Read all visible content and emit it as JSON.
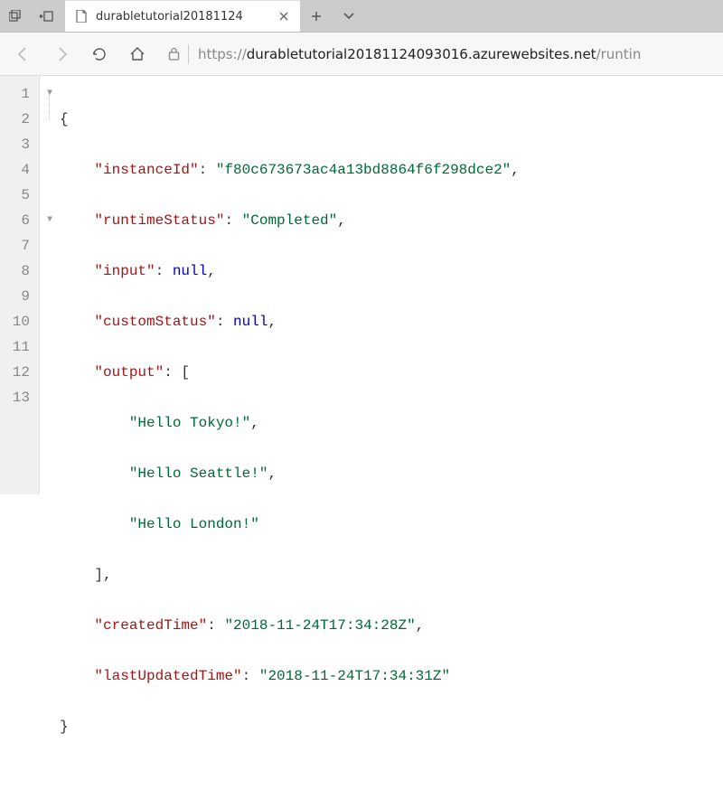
{
  "titlebar": {
    "tab_title": "durabletutorial20181124"
  },
  "navbar": {
    "url_scheme": "https://",
    "url_host": "durabletutorial20181124093016.azurewebsites.net",
    "url_path": "/runtin"
  },
  "code": {
    "line1": "{",
    "keys": {
      "instanceId": "\"instanceId\"",
      "runtimeStatus": "\"runtimeStatus\"",
      "input": "\"input\"",
      "customStatus": "\"customStatus\"",
      "output": "\"output\"",
      "createdTime": "\"createdTime\"",
      "lastUpdatedTime": "\"lastUpdatedTime\""
    },
    "vals": {
      "instanceId": "\"f80c673673ac4a13bd8864f6f298dce2\"",
      "runtimeStatus": "\"Completed\"",
      "null": "null",
      "tokyo": "\"Hello Tokyo!\"",
      "seattle": "\"Hello Seattle!\"",
      "london": "\"Hello London!\"",
      "createdTime": "\"2018-11-24T17:34:28Z\"",
      "lastUpdatedTime": "\"2018-11-24T17:34:31Z\""
    },
    "lines": [
      "1",
      "2",
      "3",
      "4",
      "5",
      "6",
      "7",
      "8",
      "9",
      "10",
      "11",
      "12",
      "13"
    ]
  }
}
